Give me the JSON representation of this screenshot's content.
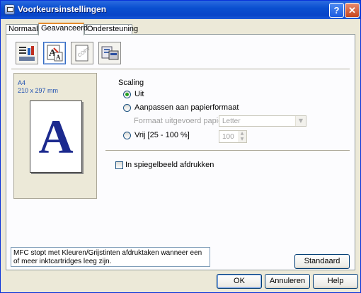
{
  "window": {
    "title": "Voorkeursinstellingen"
  },
  "tabs": [
    "Normaal",
    "Geavanceerd",
    "Ondersteuning"
  ],
  "icons": [
    "basic-settings-icon",
    "advanced-print-icon",
    "copy-watermark-icon",
    "device-options-icon"
  ],
  "preview": {
    "paper_name": "A4",
    "paper_size": "210 x 297 mm",
    "sample_glyph": "A"
  },
  "scaling": {
    "title": "Scaling",
    "options": [
      {
        "label": "Uit",
        "checked": true
      },
      {
        "label": "Aanpassen aan papierformaat",
        "checked": false
      },
      {
        "label": "Vrij [25 - 100 %]",
        "checked": false
      }
    ],
    "paper_format_label": "Formaat uitgevoerd papier",
    "paper_format_value": "Letter",
    "free_value": "100"
  },
  "mirror": {
    "label": "In spiegelbeeld afdrukken",
    "checked": false
  },
  "status_message": "MFC stopt met Kleuren/Grijstinten afdruktaken wanneer een of meer inktcartridges leeg zijn.",
  "buttons": {
    "default": "Standaard",
    "ok": "OK",
    "cancel": "Annuleren",
    "help": "Help"
  }
}
